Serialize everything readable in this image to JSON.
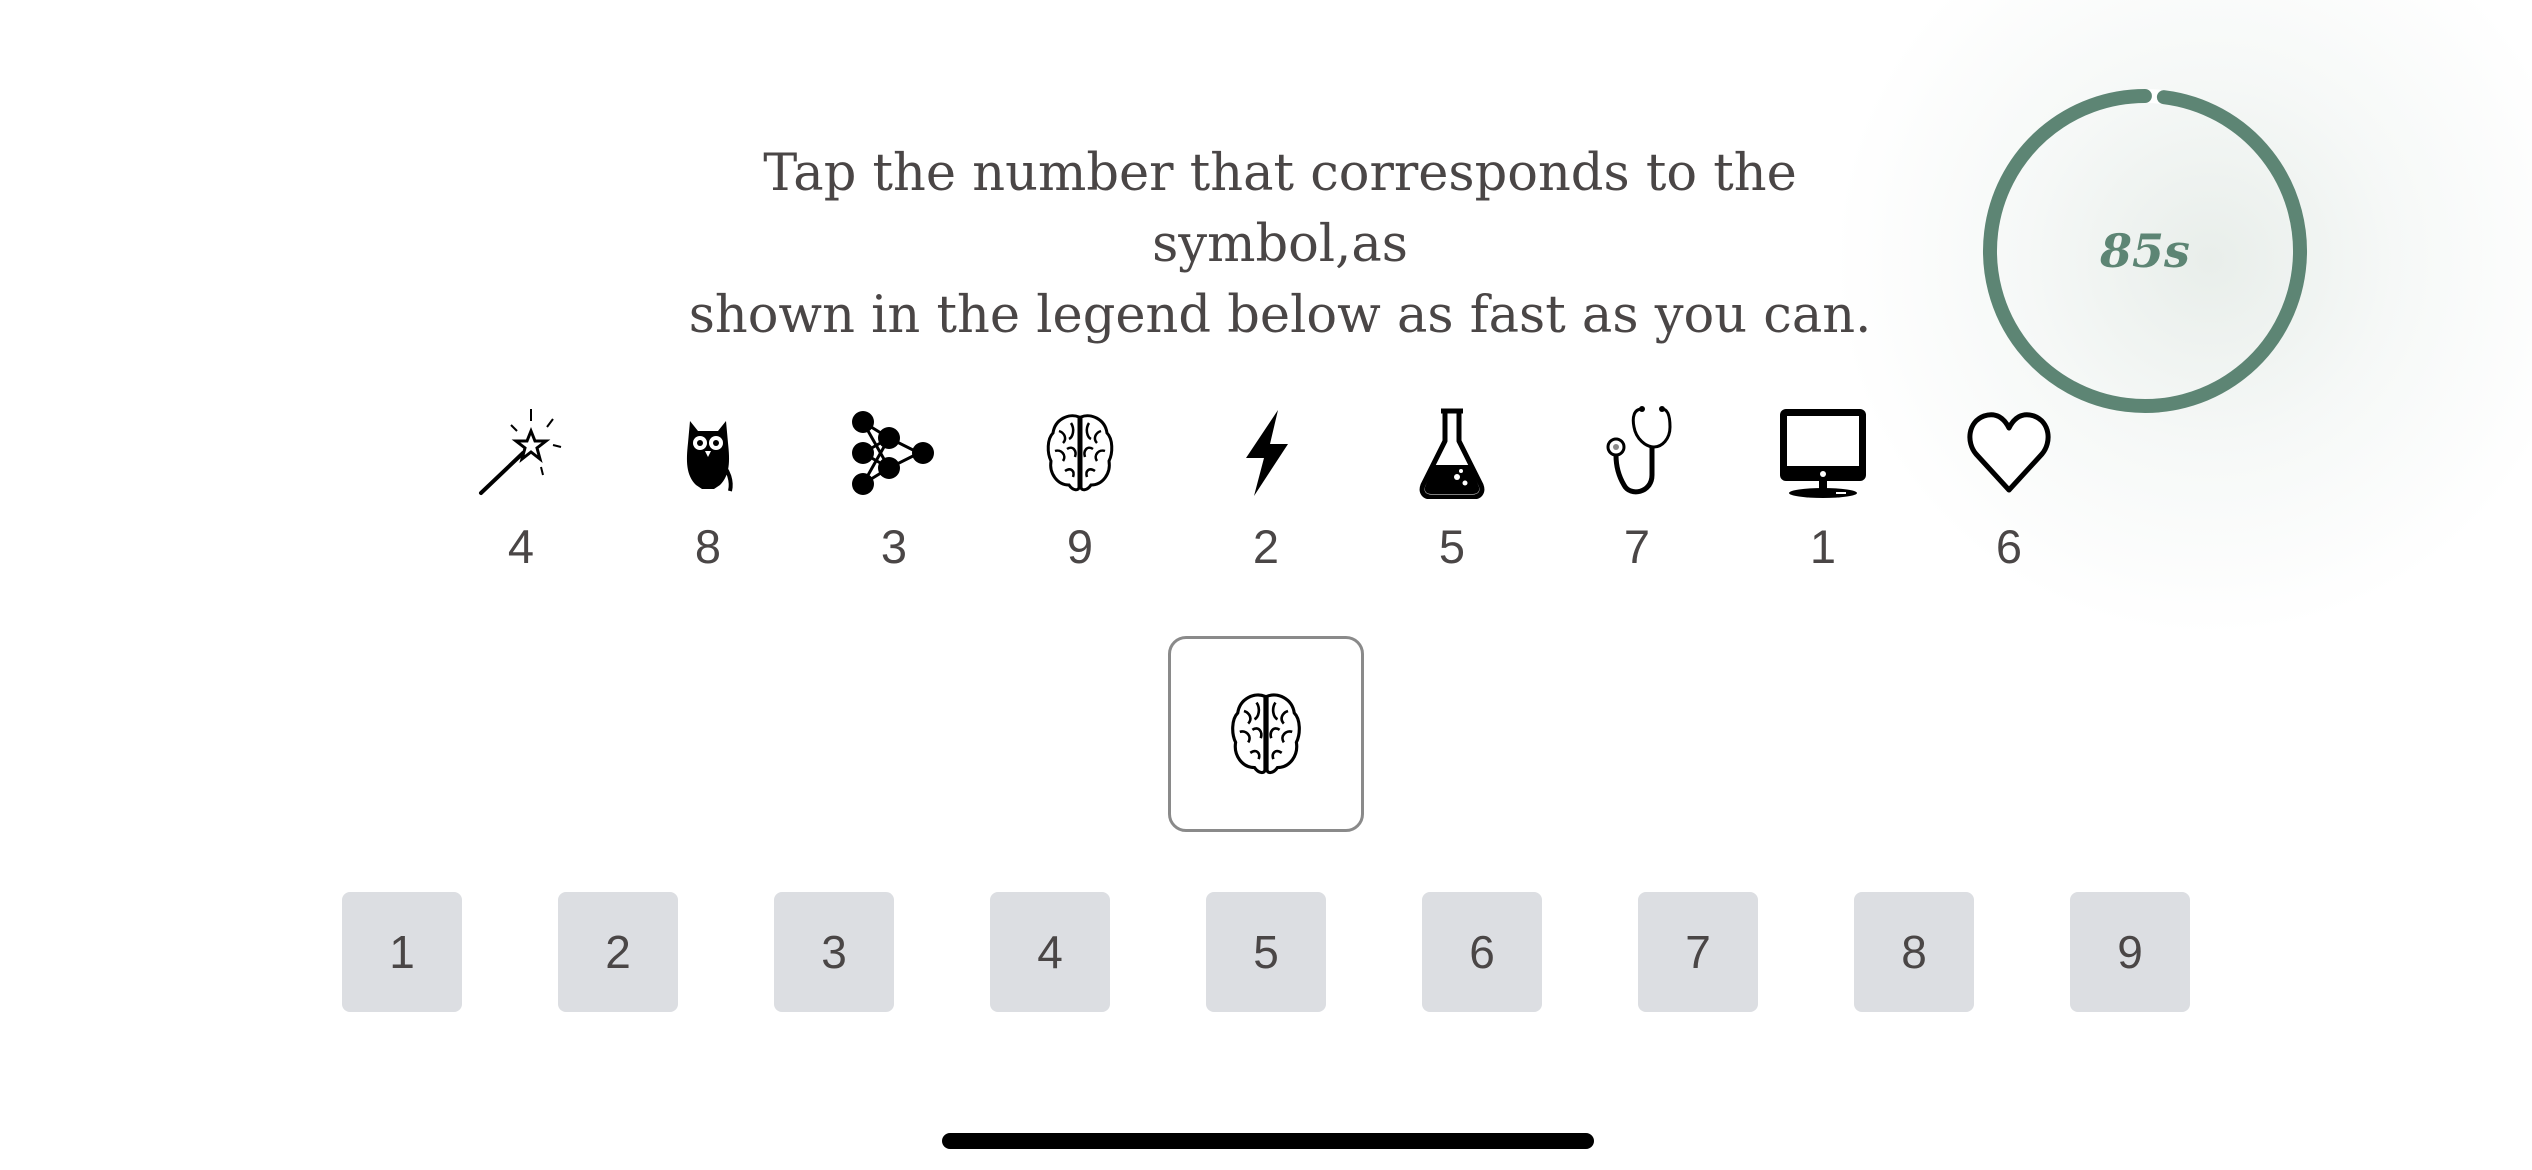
{
  "instructions": {
    "line1": "Tap the number that corresponds to the",
    "line2": "symbol,as",
    "line3": "shown in the legend below as fast as you can."
  },
  "timer": {
    "label": "85s",
    "remaining_fraction": 0.98,
    "color": "#5d8574"
  },
  "legend": [
    {
      "icon": "magic-wand-icon",
      "number": "4"
    },
    {
      "icon": "owl-icon",
      "number": "8"
    },
    {
      "icon": "network-nodes-icon",
      "number": "3"
    },
    {
      "icon": "brain-icon",
      "number": "9"
    },
    {
      "icon": "lightning-bolt-icon",
      "number": "2"
    },
    {
      "icon": "flask-icon",
      "number": "5"
    },
    {
      "icon": "stethoscope-icon",
      "number": "7"
    },
    {
      "icon": "monitor-icon",
      "number": "1"
    },
    {
      "icon": "heart-outline-icon",
      "number": "6"
    }
  ],
  "target": {
    "icon": "brain-icon"
  },
  "keypad": [
    "1",
    "2",
    "3",
    "4",
    "5",
    "6",
    "7",
    "8",
    "9"
  ],
  "colors": {
    "text": "#4a4646",
    "key_background": "#dcdee2",
    "accent": "#5d8574"
  }
}
